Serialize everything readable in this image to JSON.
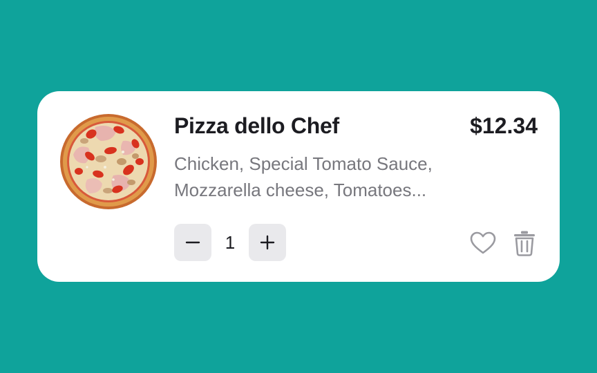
{
  "product": {
    "name": "Pizza dello Chef",
    "price": "$12.34",
    "description_lines": [
      "Chicken, Special Tomato Sauce,",
      "Mozzarella cheese, Tomatoes..."
    ],
    "image": "pizza-image"
  },
  "quantity": {
    "value": "1",
    "decrement_icon": "minus-icon",
    "increment_icon": "plus-icon"
  },
  "actions": {
    "favorite_icon": "heart-icon",
    "delete_icon": "trash-icon"
  },
  "colors": {
    "background": "#0fa39b",
    "card": "#ffffff",
    "text_primary": "#1c1c21",
    "text_secondary": "#77777d",
    "button_bg": "#e9e9ec",
    "icon_gray": "#9a9aa0"
  }
}
